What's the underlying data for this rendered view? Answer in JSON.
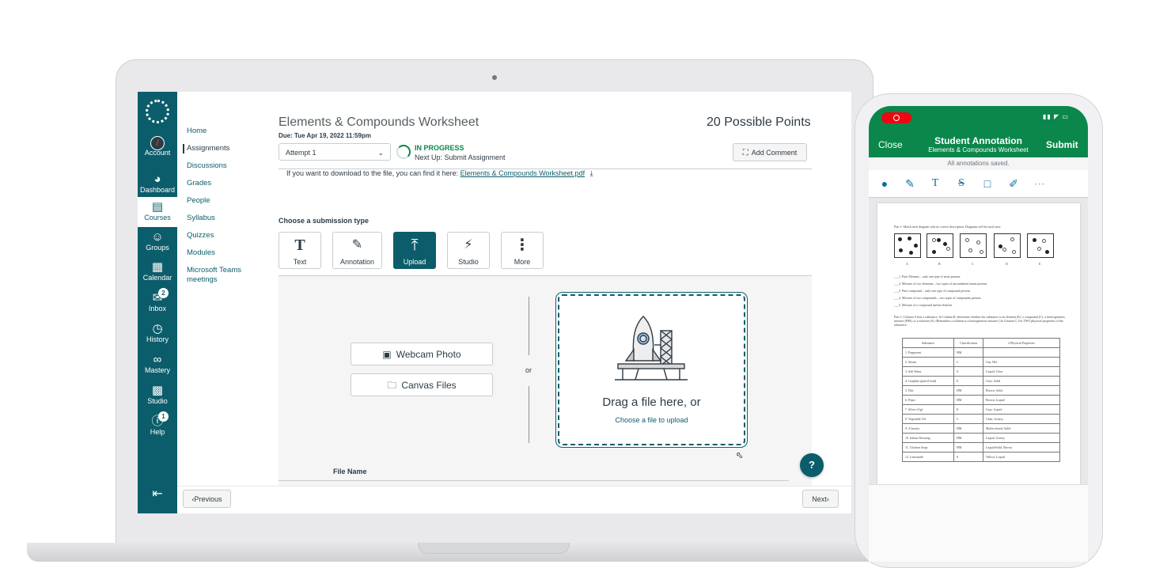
{
  "canvas": {
    "global_nav": [
      {
        "label": "Account",
        "icon": "account-icon"
      },
      {
        "label": "Dashboard",
        "icon": "dashboard-icon"
      },
      {
        "label": "Courses",
        "icon": "courses-icon"
      },
      {
        "label": "Groups",
        "icon": "groups-icon"
      },
      {
        "label": "Calendar",
        "icon": "calendar-icon"
      },
      {
        "label": "Inbox",
        "icon": "inbox-icon",
        "badge": "2"
      },
      {
        "label": "History",
        "icon": "history-icon"
      },
      {
        "label": "Mastery",
        "icon": "mastery-icon"
      },
      {
        "label": "Studio",
        "icon": "studio-icon"
      },
      {
        "label": "Help",
        "icon": "help-icon",
        "badge": "1"
      }
    ],
    "course_nav": [
      "Home",
      "Assignments",
      "Discussions",
      "Grades",
      "People",
      "Syllabus",
      "Quizzes",
      "Modules",
      "Microsoft Teams meetings"
    ],
    "assignment": {
      "title": "Elements & Compounds Worksheet",
      "due": "Due: Tue Apr 19, 2022 11:59pm",
      "points": "20 Possible Points",
      "attempt": "Attempt 1",
      "status": "IN PROGRESS",
      "next_up": "Next Up: Submit Assignment",
      "add_comment": "Add Comment",
      "download_text": "If you want to download to the file, you can find it here:",
      "download_link": "Elements & Compounds Worksheet.pdf",
      "choose_type": "Choose a submission type",
      "types": [
        "Text",
        "Annotation",
        "Upload",
        "Studio",
        "More"
      ],
      "active_type": "Upload",
      "webcam": "Webcam Photo",
      "canvas_files": "Canvas Files",
      "or": "or",
      "drag_text": "Drag a file here, or",
      "choose_file": "Choose a file to upload",
      "file_name_header": "File Name",
      "previous": "Previous",
      "next": "Next"
    },
    "accent": "#0c5d6b"
  },
  "phone": {
    "close": "Close",
    "title": "Student Annotation",
    "subtitle": "Elements & Compounds Worksheet",
    "submit": "Submit",
    "saved": "All annotations saved.",
    "tools": [
      "pin-icon",
      "pencil-icon",
      "text-icon",
      "strikethrough-icon",
      "box-icon",
      "brush-icon",
      "more-icon"
    ],
    "header_color": "#0b874b",
    "worksheet": {
      "part1": "Part 1: Match each diagram with its correct description. Diagrams will be used once.",
      "letters": [
        "A",
        "B",
        "C",
        "D",
        "E"
      ],
      "descriptions": [
        "___1. Pure Element – only one type of atom present.",
        "___2. Mixture of two elements – two types of uncombined atoms present.",
        "___3. Pure compound – only one type of compound present.",
        "___4. Mixture of two compounds – two types of compounds present.",
        "___5. Mixture of a compound and an element."
      ],
      "part2": "Part 2: Column A lists a substance. In Column B, determine whether the substance is an element (E), a compound (C), a heterogeneous mixture (HM), or a solution (S). (Remember a solution is a homogeneous mixture.) In Column C, list TWO physical properties of the substance.",
      "table_headers": [
        "Substance",
        "Classification",
        "2 Physical Properties"
      ],
      "rows": [
        [
          "1. Pepperoni",
          "HM",
          ""
        ],
        [
          "2. Steam",
          "C",
          "Gas, Hot"
        ],
        [
          "3. Salt Water",
          "S",
          "Liquid, Clear"
        ],
        [
          "4. Graphite (pencil lead)",
          "E",
          "Grey, Solid"
        ],
        [
          "5. Dirt",
          "HM",
          "Brown, Solid"
        ],
        [
          "6. Pepsi",
          "HM",
          "Brown, Liquid"
        ],
        [
          "7. Silver (Ag)",
          "E",
          "Gray, Liquid"
        ],
        [
          "8. Vegetable Oil",
          "C",
          "Clear, Greasy"
        ],
        [
          "9. A burrito",
          "HM",
          "Multicolored, Solid"
        ],
        [
          "10. Italian Dressing",
          "HM",
          "Liquid, Greasy"
        ],
        [
          "11. Chicken Soup",
          "HM",
          "Liquid/Solid, Brown"
        ],
        [
          "12. Lemonade",
          "S",
          "Yellow, Liquid"
        ]
      ]
    }
  }
}
